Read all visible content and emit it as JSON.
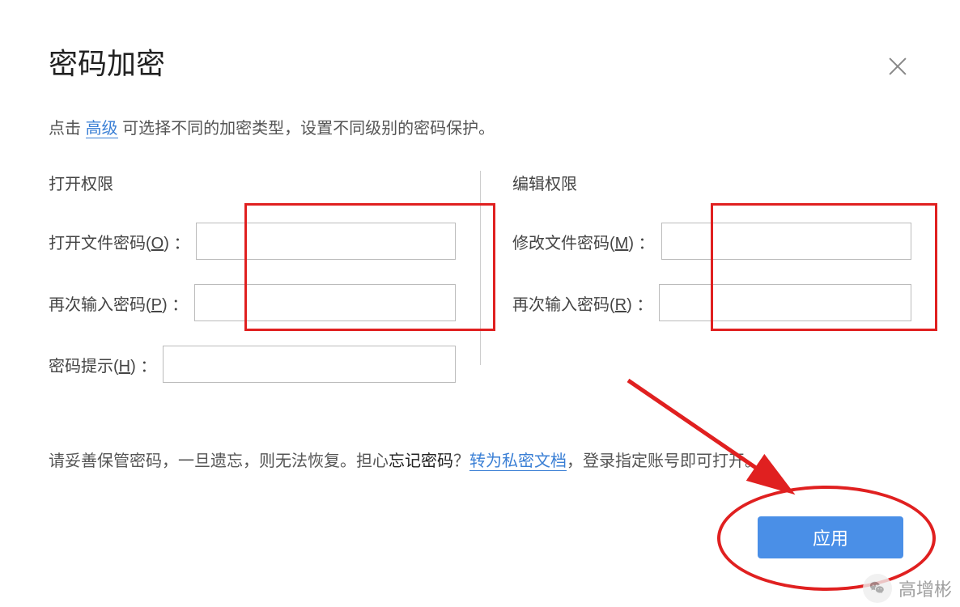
{
  "dialog": {
    "title": "密码加密",
    "description_prefix": "点击 ",
    "advanced_link": "高级",
    "description_suffix": " 可选择不同的加密类型，设置不同级别的密码保护。",
    "close_label": "关闭"
  },
  "left": {
    "section_title": "打开权限",
    "open_password_label": "打开文件密码(",
    "open_password_mnemonic": "O",
    "open_password_suffix": ") ：",
    "open_password_value": "",
    "repeat_password_label": "再次输入密码(",
    "repeat_password_mnemonic": "P",
    "repeat_password_suffix": ") ：",
    "repeat_password_value": "",
    "hint_label": "密码提示(",
    "hint_mnemonic": "H",
    "hint_suffix": ") ：",
    "hint_value": ""
  },
  "right": {
    "section_title": "编辑权限",
    "modify_password_label": "修改文件密码(",
    "modify_password_mnemonic": "M",
    "modify_password_suffix": ") ：",
    "modify_password_value": "",
    "repeat_password_label": "再次输入密码(",
    "repeat_password_mnemonic": "R",
    "repeat_password_suffix": ") ：",
    "repeat_password_value": ""
  },
  "footer": {
    "text_prefix": "请妥善保管密码，一旦遗忘，则无法恢复。担心",
    "forgot_text": "忘记密码",
    "question": "？",
    "convert_link": "转为私密文档",
    "text_suffix": "，登录指定账号即可打开。"
  },
  "apply_button": "应用",
  "watermark": {
    "text": "高增彬"
  }
}
